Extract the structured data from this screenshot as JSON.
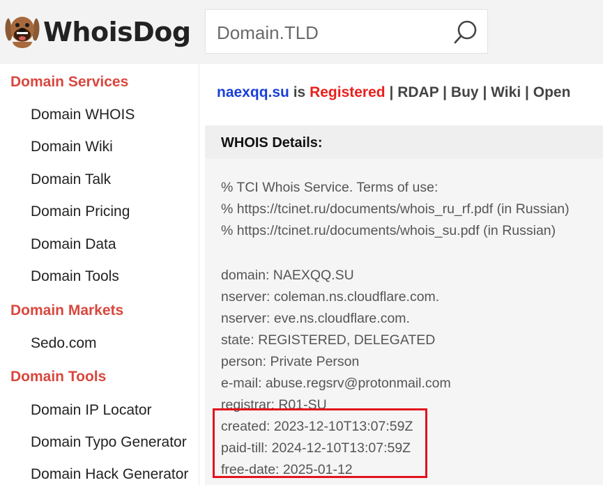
{
  "header": {
    "logo_text": "WhoisDog",
    "search_placeholder": "Domain.TLD"
  },
  "sidebar": {
    "sections": [
      {
        "title": "Domain Services",
        "items": [
          "Domain WHOIS",
          "Domain Wiki",
          "Domain Talk",
          "Domain Pricing",
          "Domain Data",
          "Domain Tools"
        ]
      },
      {
        "title": "Domain Markets",
        "items": [
          "Sedo.com"
        ]
      },
      {
        "title": "Domain Tools",
        "items": [
          "Domain IP Locator",
          "Domain Typo Generator",
          "Domain Hack Generator"
        ]
      }
    ]
  },
  "status": {
    "domain": "naexqq.su",
    "is_text": "is",
    "state": "Registered",
    "links": [
      "RDAP",
      "Buy",
      "Wiki",
      "Open"
    ],
    "separator": "|"
  },
  "whois": {
    "heading": "WHOIS Details:",
    "lines": [
      "% TCI Whois Service. Terms of use:",
      "% https://tcinet.ru/documents/whois_ru_rf.pdf (in Russian)",
      "% https://tcinet.ru/documents/whois_su.pdf (in Russian)",
      "domain: NAEXQQ.SU",
      "nserver: coleman.ns.cloudflare.com.",
      "nserver: eve.ns.cloudflare.com.",
      "state: REGISTERED, DELEGATED",
      "person: Private Person",
      "e-mail: abuse.regsrv@protonmail.com",
      "registrar: R01-SU",
      "created: 2023-12-10T13:07:59Z",
      "paid-till: 2024-12-10T13:07:59Z",
      "free-date: 2025-01-12"
    ]
  },
  "colors": {
    "section_title": "#d9473e",
    "domain_link": "#1a3fd6",
    "registered": "#e8201c",
    "highlight_box": "#e3131b"
  }
}
